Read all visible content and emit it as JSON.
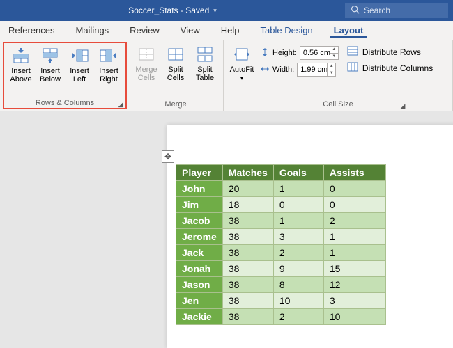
{
  "title": {
    "filename": "Soccer_Stats",
    "status": "Saved"
  },
  "search": {
    "placeholder": "Search"
  },
  "tabs": [
    "References",
    "Mailings",
    "Review",
    "View",
    "Help",
    "Table Design",
    "Layout"
  ],
  "ribbon": {
    "rows_cols": {
      "label": "Rows & Columns",
      "insert_above": "Insert\nAbove",
      "insert_below": "Insert\nBelow",
      "insert_left": "Insert\nLeft",
      "insert_right": "Insert\nRight"
    },
    "merge": {
      "label": "Merge",
      "merge_cells": "Merge\nCells",
      "split_cells": "Split\nCells",
      "split_table": "Split\nTable"
    },
    "cellsize": {
      "label": "Cell Size",
      "autofit": "AutoFit",
      "height_label": "Height:",
      "height_value": "0.56 cm",
      "width_label": "Width:",
      "width_value": "1.99 cm",
      "dist_rows": "Distribute Rows",
      "dist_cols": "Distribute Columns"
    }
  },
  "table": {
    "headers": [
      "Player",
      "Matches",
      "Goals",
      "Assists"
    ],
    "rows": [
      {
        "name": "John",
        "matches": "20",
        "goals": "1",
        "assists": "0"
      },
      {
        "name": "Jim",
        "matches": "18",
        "goals": "0",
        "assists": "0"
      },
      {
        "name": "Jacob",
        "matches": "38",
        "goals": "1",
        "assists": "2"
      },
      {
        "name": "Jerome",
        "matches": "38",
        "goals": "3",
        "assists": "1"
      },
      {
        "name": "Jack",
        "matches": "38",
        "goals": "2",
        "assists": "1"
      },
      {
        "name": "Jonah",
        "matches": "38",
        "goals": "9",
        "assists": "15"
      },
      {
        "name": "Jason",
        "matches": "38",
        "goals": "8",
        "assists": "12"
      },
      {
        "name": "Jen",
        "matches": "38",
        "goals": "10",
        "assists": "3"
      },
      {
        "name": "Jackie",
        "matches": "38",
        "goals": "2",
        "assists": "10"
      }
    ]
  }
}
